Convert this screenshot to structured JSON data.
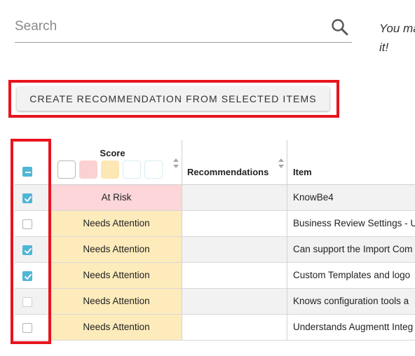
{
  "search": {
    "placeholder": "Search",
    "value": ""
  },
  "hint": {
    "line1": "You ma",
    "line2": "it!"
  },
  "create_button": {
    "label": "CREATE RECOMMENDATION FROM SELECTED ITEMS"
  },
  "table": {
    "columns": {
      "score": "Score",
      "recommendations": "Recommendations",
      "item": "Item"
    },
    "header_checkbox_state": "indeterminate",
    "score_filter_swatches": [
      {
        "color": "#ffffff",
        "border": "#b8b8b8"
      },
      {
        "color": "#fbd1d3",
        "border": "#fbd1d3"
      },
      {
        "color": "#fde7b5",
        "border": "#fde7b5"
      },
      {
        "color": "#ffffff",
        "border": "#d8ecf2"
      },
      {
        "color": "#ffffff",
        "border": "#d8ecf2"
      }
    ],
    "rows": [
      {
        "checked": true,
        "score": "At Risk",
        "score_color": "#fcd6d8",
        "recommendation": "",
        "item": "KnowBe4",
        "row_bg": "#f2f2f2"
      },
      {
        "checked": false,
        "score": "Needs Attention",
        "score_color": "#fdebbb",
        "recommendation": "",
        "item": "Business Review Settings - U",
        "row_bg": "#ffffff"
      },
      {
        "checked": true,
        "score": "Needs Attention",
        "score_color": "#fdebbb",
        "recommendation": "",
        "item": "Can support the Import Com",
        "row_bg": "#f2f2f2"
      },
      {
        "checked": true,
        "score": "Needs Attention",
        "score_color": "#fdebbb",
        "recommendation": "",
        "item": "Custom Templates and logo",
        "row_bg": "#ffffff"
      },
      {
        "checked": false,
        "score": "Needs Attention",
        "score_color": "#fdebbb",
        "recommendation": "",
        "item": "Knows configuration tools a",
        "row_bg": "#f2f2f2"
      },
      {
        "checked": false,
        "score": "Needs Attention",
        "score_color": "#fdebbb",
        "recommendation": "",
        "item": "Understands Augmentt Integ",
        "row_bg": "#ffffff"
      }
    ]
  },
  "colors": {
    "accent": "#4fb6d6",
    "highlight": "#e8141e"
  }
}
